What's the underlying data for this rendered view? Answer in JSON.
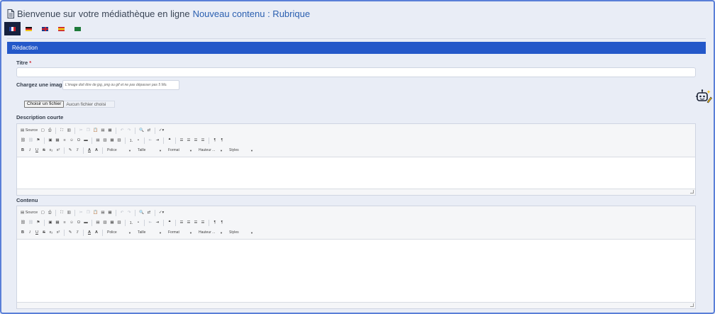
{
  "header": {
    "title": "Bienvenue sur votre médiathèque en ligne",
    "subtitle": "Nouveau contenu : Rubrique",
    "icon": "document-icon"
  },
  "languages": [
    {
      "code": "fr",
      "icon": "flag-fr-icon",
      "active": true
    },
    {
      "code": "de",
      "icon": "flag-de-icon",
      "active": false
    },
    {
      "code": "gb",
      "icon": "flag-gb-icon",
      "active": false
    },
    {
      "code": "es",
      "icon": "flag-es-icon",
      "active": false
    },
    {
      "code": "sa",
      "icon": "flag-sa-icon",
      "active": false
    }
  ],
  "section": {
    "label": "Rédaction"
  },
  "form": {
    "title_label": "Titre",
    "required_mark": "*",
    "title_value": "",
    "image_label": "Chargez une image",
    "image_hint": "L'image doit être de jpg, png ou gif et ne pas dépasser pas 5 Mo.",
    "file_button": "Choisir un fichier",
    "file_status": "Aucun fichier choisi",
    "short_desc_label": "Description courte",
    "content_label": "Contenu"
  },
  "editor_toolbar": {
    "source": "Source",
    "bold": "B",
    "italic": "I",
    "underline": "U",
    "strike": "S",
    "subscript": "x₂",
    "superscript": "x²",
    "text_color": "A",
    "bg_color": "A",
    "font": "Police",
    "size": "Taille",
    "format": "Format",
    "height": "Hauteur ...",
    "styles": "Styles"
  },
  "colors": {
    "accent": "#2458c9",
    "frame_border": "#5a7fd8",
    "required": "#d0202a",
    "subtitle": "#2a5fb0"
  }
}
